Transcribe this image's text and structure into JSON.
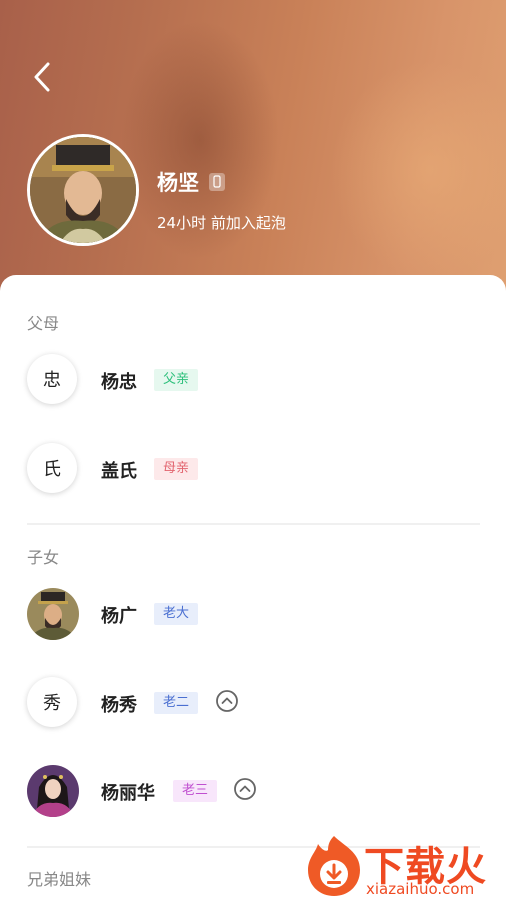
{
  "profile": {
    "name": "杨坚",
    "subtitle": "24小时 前加入起泡"
  },
  "sections": {
    "parents": "父母",
    "children": "子女",
    "siblings": "兄弟姐妹"
  },
  "parents": [
    {
      "avatar_char": "忠",
      "name": "杨忠",
      "tag": "父亲",
      "tag_bg": "#e6f8ef",
      "tag_fg": "#2bbf7a"
    },
    {
      "avatar_char": "氏",
      "name": "盖氏",
      "tag": "母亲",
      "tag_bg": "#fde9ea",
      "tag_fg": "#e2646f"
    }
  ],
  "children": [
    {
      "avatar_char": "",
      "name": "杨广",
      "tag": "老大",
      "tag_bg": "#e8eefb",
      "tag_fg": "#4a6fd1"
    },
    {
      "avatar_char": "秀",
      "name": "杨秀",
      "tag": "老二",
      "tag_bg": "#e8eefb",
      "tag_fg": "#4a6fd1"
    },
    {
      "avatar_char": "",
      "name": "杨丽华",
      "tag": "老三",
      "tag_bg": "#f8e6fb",
      "tag_fg": "#c04fd0"
    }
  ],
  "watermark": {
    "title": "下载火",
    "url": "xiazaihuo.com"
  },
  "icons": {
    "back": "chevron-left-icon",
    "phone": "phone-icon",
    "expand": "chevron-up-circle-icon"
  }
}
